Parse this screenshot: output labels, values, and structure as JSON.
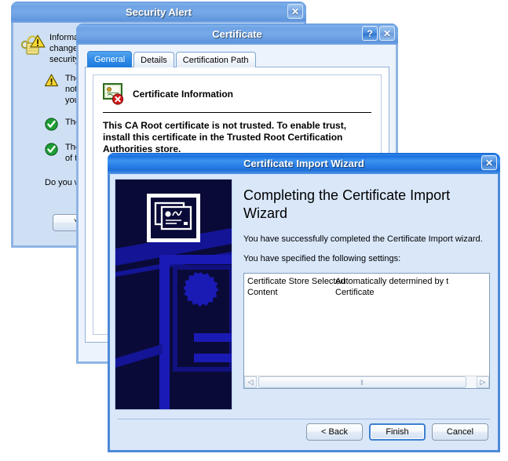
{
  "security_alert": {
    "title": "Security Alert",
    "close_label": "✕",
    "header_text": "Information you exchange with this site cannot be viewed or\nchanged by others. However, there is a problem with the site's\nsecurity certificate.",
    "items": [
      {
        "icon": "warning-triangle-icon",
        "text": "The security certificate was issued by a company you have\nnot chosen to trust. View the certificate to determine whether\nyou want to trust the certifying authority."
      },
      {
        "icon": "check-circle-icon",
        "text": "The security certificate date is valid."
      },
      {
        "icon": "check-circle-icon",
        "text": "The security certificate has a valid name matching the name\nof the page you are trying to view."
      }
    ],
    "question": "Do you want to proceed?",
    "buttons": [
      {
        "label": "Yes"
      }
    ],
    "lock_icon": "padlock-warning-icon"
  },
  "certificate": {
    "title": "Certificate",
    "help_label": "?",
    "close_label": "✕",
    "tabs": [
      {
        "label": "General",
        "selected": true
      },
      {
        "label": "Details",
        "selected": false
      },
      {
        "label": "Certification Path",
        "selected": false
      }
    ],
    "info_icon": "certificate-error-icon",
    "info_title": "Certificate Information",
    "warning_text": "This CA Root certificate is not trusted. To enable trust,\ninstall this certificate in the Trusted Root Certification\nAuthorities store."
  },
  "import_wizard": {
    "title": "Certificate Import Wizard",
    "close_label": "✕",
    "artwork_icon": "certificate-stack-watermark",
    "heading": "Completing the Certificate Import\nWizard",
    "paragraph_1": "You have successfully completed the Certificate Import\nwizard.",
    "paragraph_2": "You have specified the following settings:",
    "settings": [
      {
        "key": "Certificate Store Selected",
        "value": "Automatically determined by t"
      },
      {
        "key": "Content",
        "value": "Certificate"
      }
    ],
    "scrollbar": {
      "left_arrow": "◁",
      "right_arrow": "▷",
      "grip": "‖"
    },
    "buttons": [
      {
        "label": "< Back",
        "default": false
      },
      {
        "label": "Finish",
        "default": true
      },
      {
        "label": "Cancel",
        "default": false
      }
    ]
  },
  "colors": {
    "titlebar_active": "#2f84e8",
    "titlebar_inactive": "#7aa9e6",
    "dialog_face": "#ecf3fd",
    "security_face": "#cfe0f4",
    "wizard_face": "#d9e7f9",
    "frame_border": "#4d8ad8",
    "watermark_bg": "#0a0a3c",
    "watermark_accent": "#1414a0",
    "tab_selected": "#2e8be6",
    "warning_yellow": "#f5d033",
    "success_green": "#1e9e36",
    "error_red": "#d01818"
  }
}
